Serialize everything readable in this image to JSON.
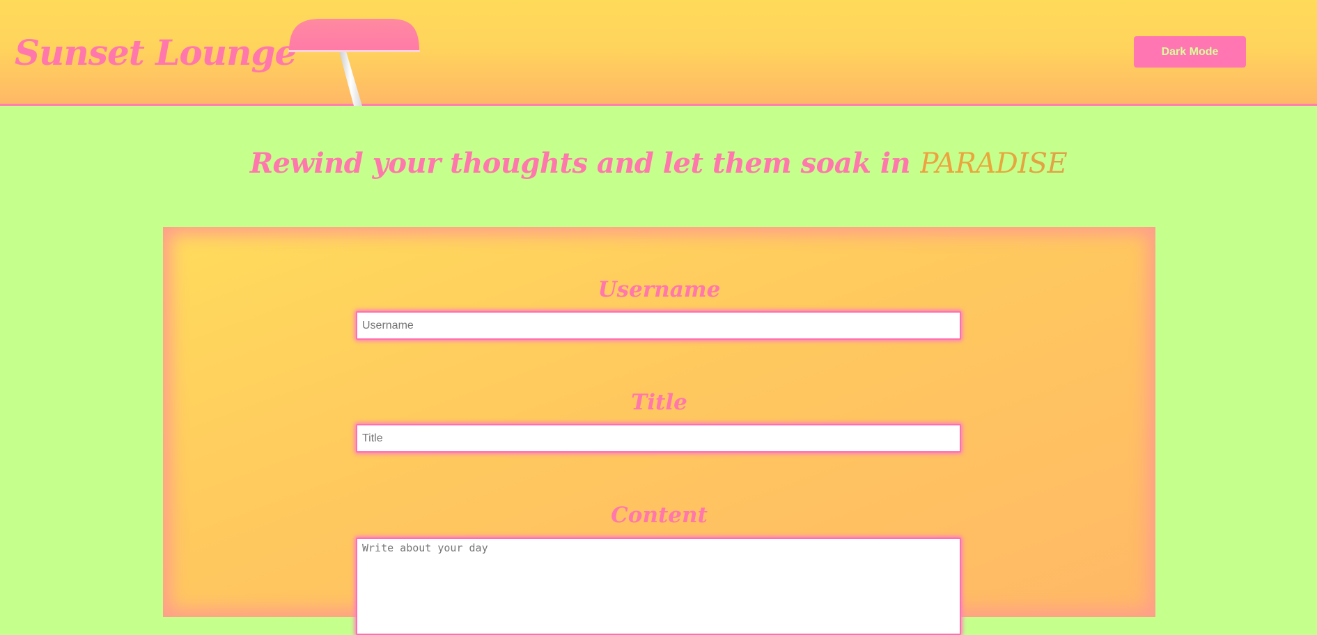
{
  "header": {
    "site_title": "Sunset Lounge",
    "dark_mode_label": "Dark Mode"
  },
  "tagline": {
    "text": "Rewind your thoughts and let them soak in ",
    "highlight": "PARADISE"
  },
  "form": {
    "username": {
      "label": "Username",
      "placeholder": "Username",
      "value": ""
    },
    "title": {
      "label": "Title",
      "placeholder": "Title",
      "value": ""
    },
    "content": {
      "label": "Content",
      "placeholder": "Write about your day",
      "value": ""
    }
  },
  "colors": {
    "page_background": "#c5ff8c",
    "accent_pink": "#ff77ac",
    "header_yellow": "#ffdb5a",
    "header_orange": "#ffb866",
    "highlight_orange": "#e8a83a"
  },
  "icons": {
    "umbrella": "beach-umbrella-icon"
  }
}
